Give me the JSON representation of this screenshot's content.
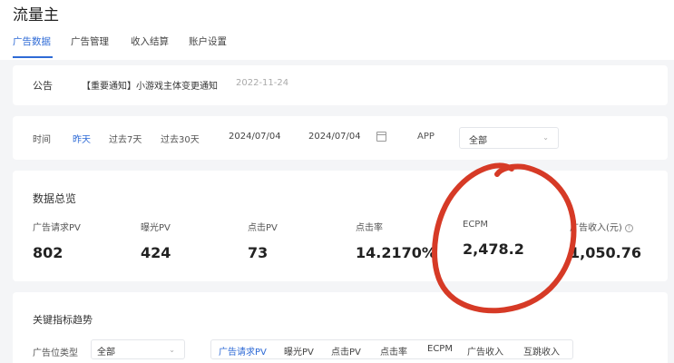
{
  "app": {
    "title": "流量主"
  },
  "tabs": [
    {
      "label": "广告数据"
    },
    {
      "label": "广告管理"
    },
    {
      "label": "收入结算"
    },
    {
      "label": "账户设置"
    }
  ],
  "notice": {
    "label": "公告",
    "text": "【重要通知】小游戏主体变更通知",
    "date": "2022-11-24"
  },
  "filter": {
    "time_label": "时间",
    "quick_ranges": [
      "昨天",
      "过去7天",
      "过去30天"
    ],
    "start_date": "2024/07/04",
    "end_date": "2024/07/04",
    "app_label": "APP",
    "app_value": "全部"
  },
  "overview": {
    "title": "数据总览",
    "metrics": [
      {
        "label": "广告请求PV",
        "value": "802"
      },
      {
        "label": "曝光PV",
        "value": "424"
      },
      {
        "label": "点击PV",
        "value": "73"
      },
      {
        "label": "点击率",
        "value": "14.2170%"
      },
      {
        "label": "ECPM",
        "value": "2,478.2"
      },
      {
        "label": "广告收入(元)",
        "value": "1,050.76"
      }
    ]
  },
  "trend": {
    "title": "关键指标趋势",
    "slot_label": "广告位类型",
    "slot_value": "全部",
    "metric_tabs": [
      "广告请求PV",
      "曝光PV",
      "点击PV",
      "点击率",
      "ECPM",
      "广告收入",
      "互跳收入"
    ]
  },
  "colors": {
    "accent": "#2f6bd6",
    "annotation": "#d63a26"
  }
}
